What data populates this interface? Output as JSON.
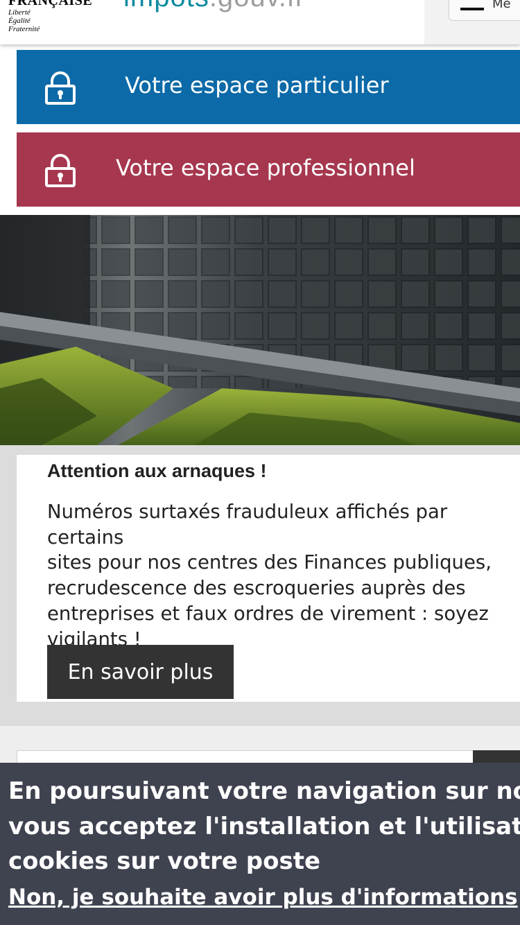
{
  "header": {
    "republic_name": "FRANÇAISE",
    "motto": [
      "Liberté",
      "Égalité",
      "Fraternité"
    ],
    "site_logo_main": "impots",
    "site_logo_suffix": ".gouv.fr",
    "menu_label": "Me"
  },
  "spaces": {
    "particulier_label": "Votre espace particulier",
    "professionnel_label": "Votre espace professionnel",
    "particulier_color": "#0c6aa8",
    "professionnel_color": "#a6374f"
  },
  "alert": {
    "title": "Attention aux arnaques !",
    "text_lines": [
      "Numéros surtaxés frauduleux affichés par certains",
      "sites pour nos centres des Finances publiques,",
      "recrudescence des escroqueries auprès des",
      "entreprises et faux ordres de virement : soyez",
      "vigilants !"
    ],
    "button_label": "En savoir plus"
  },
  "cookie_banner": {
    "message_lines": [
      "En poursuivant votre navigation sur notre site,",
      "vous acceptez l'installation et l'utilisation de",
      "cookies sur votre poste"
    ],
    "link_label": "Non, je souhaite avoir plus d'informations"
  }
}
